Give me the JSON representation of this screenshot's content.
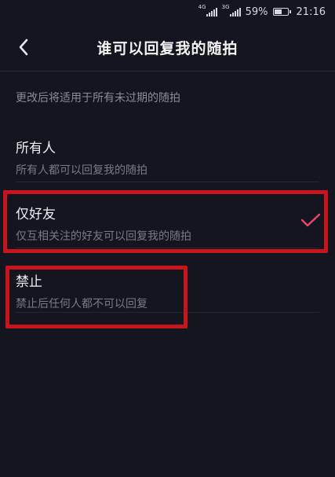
{
  "status_bar": {
    "network_1": "4G",
    "network_2": "3G",
    "battery_percent": "59%",
    "battery_level": 0.59,
    "time": "21:16"
  },
  "header": {
    "back_icon": "chevron-left-icon",
    "title": "谁可以回复我的随拍"
  },
  "hint": "更改后将适用于所有未过期的随拍",
  "options": [
    {
      "title": "所有人",
      "desc": "所有人都可以回复我的随拍",
      "selected": false
    },
    {
      "title": "仅好友",
      "desc": "仅互相关注的好友可以回复我的随拍",
      "selected": true
    },
    {
      "title": "禁止",
      "desc": "禁止后任何人都不可以回复",
      "selected": false
    }
  ],
  "colors": {
    "background": "#15151f",
    "check_accent": "#f0446a",
    "highlight_box": "#c8141c"
  }
}
